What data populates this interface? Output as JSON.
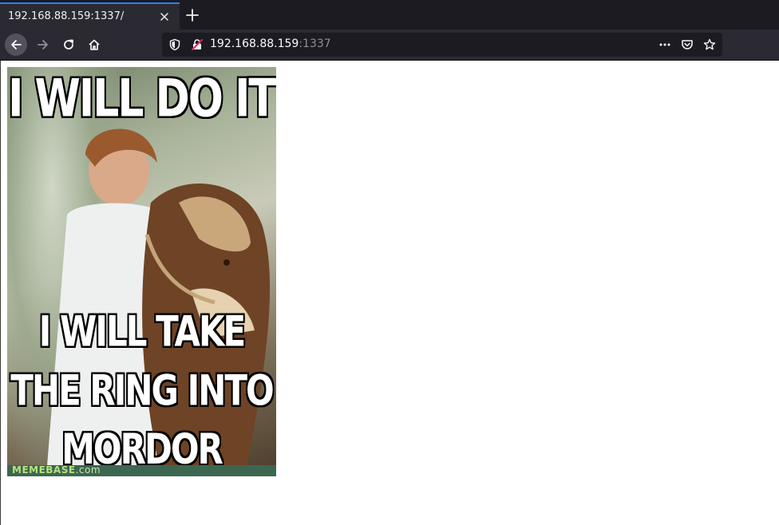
{
  "browser": {
    "tab": {
      "title": "192.168.88.159:1337/"
    },
    "urlbar": {
      "host": "192.168.88.159",
      "port": ":1337"
    },
    "colors": {
      "tab_accent": "#2f7ff2",
      "toolbar_bg": "#2b2a33",
      "tabstrip_bg": "#1c1b22"
    }
  },
  "page": {
    "meme": {
      "top_text": "I WILL DO IT",
      "bottom_text": "I WILL TAKE THE RING INTO MORDOR",
      "watermark_brand": "MEMEBASE",
      "watermark_suffix": ".com"
    }
  }
}
